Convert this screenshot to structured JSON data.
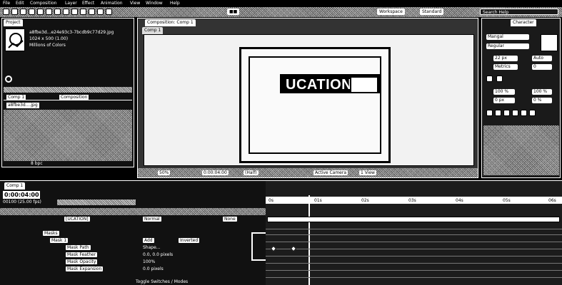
{
  "menubar": {
    "items": [
      "File",
      "Edit",
      "Composition",
      "Layer",
      "Effect",
      "Animation",
      "View",
      "Window",
      "Help"
    ]
  },
  "toolbar": {
    "workspace_label": "Workspace",
    "workspace_value": "Standard",
    "search_placeholder": "Search Help"
  },
  "project": {
    "tab_label": "Project",
    "file_name": "a8fbe3d...e24e93c3-7bcdb9c77d29.jpg",
    "file_dims": "1024 x 500 (1.00)",
    "file_type": "Millions of Colors",
    "items": [
      {
        "name": "Comp 1",
        "type": "Composition"
      },
      {
        "name": "a8fbe3d....jpg",
        "type": ""
      }
    ],
    "bpc": "8 bpc"
  },
  "comp": {
    "tab_label": "Composition: Comp 1",
    "subtab_label": "Comp 1",
    "caption_text": "UCATION",
    "zoom": "50%",
    "timecode": "0:00:04:00",
    "resolution": "(Half)",
    "camera": "Active Camera",
    "views": "1 View"
  },
  "character": {
    "tab_label": "Character",
    "font_name": "Mangal",
    "font_style": "Regular",
    "font_size": "22 px",
    "leading": "Auto",
    "kerning": "Metrics",
    "tracking": "0",
    "scale_v": "100 %",
    "scale_h": "100 %",
    "baseline": "0 px",
    "tsume": "0 %"
  },
  "timeline": {
    "comp_tab": "Comp 1",
    "timecode": "0:00:04:00",
    "fps": "00100 (25.00 fps)",
    "layer_name": "[UCATION]",
    "mode": "Normal",
    "parent": "None",
    "masks_label": "Masks",
    "mask_name": "Mask 1",
    "mask_mode": "Add",
    "inverted": "Inverted",
    "props": [
      {
        "name": "Mask Path",
        "value": "Shape..."
      },
      {
        "name": "Mask Feather",
        "value": "0.0, 0.0 pixels"
      },
      {
        "name": "Mask Opacity",
        "value": "100%"
      },
      {
        "name": "Mask Expansion",
        "value": "0.0 pixels"
      }
    ],
    "footer": "Toggle Switches / Modes",
    "ruler": [
      "0s",
      "01s",
      "02s",
      "03s",
      "04s",
      "05s",
      "06s"
    ]
  }
}
